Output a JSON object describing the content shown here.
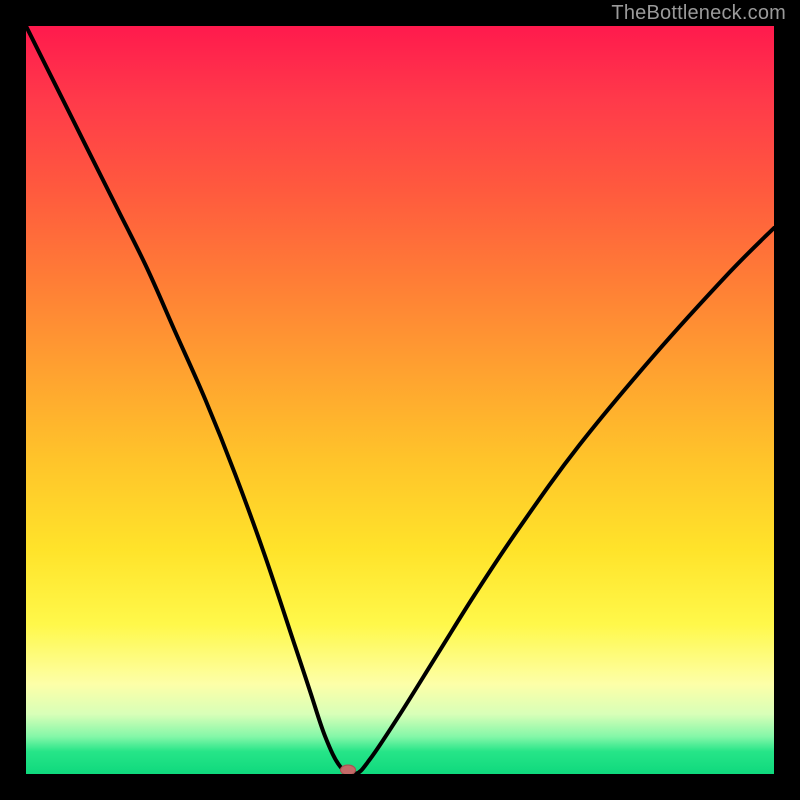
{
  "watermark": {
    "text": "TheBottleneck.com"
  },
  "colors": {
    "curve_stroke": "#000000",
    "marker_fill": "#c46a68",
    "marker_stroke": "#a55250"
  },
  "chart_data": {
    "type": "line",
    "title": "",
    "xlabel": "",
    "ylabel": "",
    "xlim": [
      0,
      100
    ],
    "ylim": [
      0,
      100
    ],
    "grid": false,
    "series": [
      {
        "name": "bottleneck-curve",
        "x": [
          0,
          4,
          8,
          12,
          16,
          20,
          24,
          28,
          32,
          36,
          38,
          40,
          42,
          44,
          46,
          50,
          55,
          60,
          66,
          74,
          84,
          94,
          100
        ],
        "y": [
          100,
          92,
          84,
          76,
          68,
          59,
          50,
          40,
          29,
          17,
          11,
          5,
          1,
          0,
          2,
          8,
          16,
          24,
          33,
          44,
          56,
          67,
          73
        ]
      }
    ],
    "annotations": [
      {
        "name": "optimal-point",
        "x": 43,
        "y": 0
      }
    ]
  }
}
